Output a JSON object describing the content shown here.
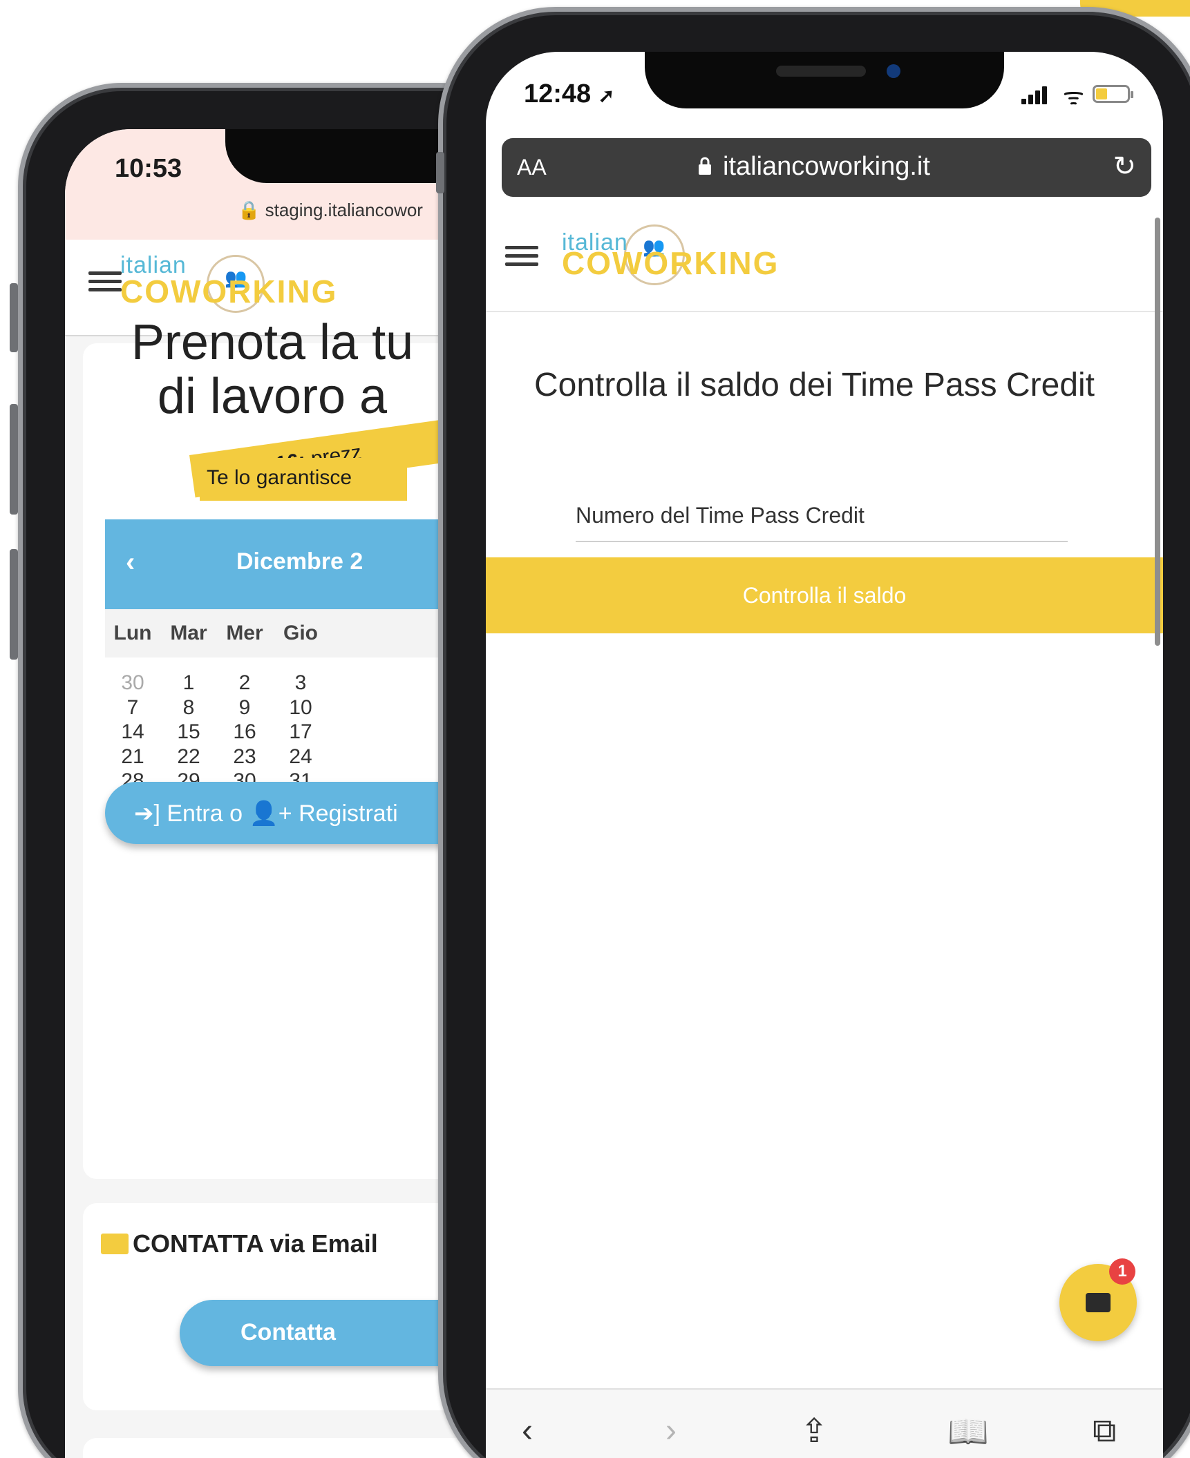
{
  "back_phone": {
    "status_time": "10:53",
    "url": "staging.italiancowor",
    "logo": {
      "top": "italian",
      "bottom": "COWORKING",
      "figures": "👥"
    },
    "hero_title_line1": "Prenota la tu",
    "hero_title_line2": "di lavoro a",
    "price_tag": {
      "strong": "a soli € 16",
      "sep": ": ",
      "link": "prezz"
    },
    "guarantee_tag": "Te lo garantisce",
    "calendar": {
      "prev_label": "‹",
      "month_label": "Dicembre 2",
      "weekdays": [
        "Lun",
        "Mar",
        "Mer",
        "Gio"
      ],
      "weeks": [
        [
          "30",
          "1",
          "2",
          "3"
        ],
        [
          "7",
          "8",
          "9",
          "10"
        ],
        [
          "14",
          "15",
          "16",
          "17"
        ],
        [
          "21",
          "22",
          "23",
          "24"
        ],
        [
          "28",
          "29",
          "30",
          "31"
        ]
      ]
    },
    "login_button": "➔] Entra o 👤+ Registrati",
    "contact_heading": "CONTATTA via Email",
    "contact_button": "Contatta"
  },
  "front_phone": {
    "status_time": "12:48",
    "location_arrow": "➚",
    "wifi_glyph": "ᯤ",
    "url_bar": {
      "text_size": "AA",
      "domain": "italiancoworking.it",
      "reload": "↻"
    },
    "logo": {
      "top": "italian",
      "bottom": "COWORKING",
      "figures": "👥"
    },
    "page_title": "Controlla il saldo dei Time Pass Credit",
    "input_placeholder": "Numero del Time Pass Credit",
    "submit_label": "Controlla il saldo",
    "chat_badge": "1",
    "toolbar": {
      "back": "‹",
      "forward": "›",
      "share": "⇪",
      "bookmarks": "📖",
      "tabs": "⧉"
    }
  },
  "colors": {
    "accent_yellow": "#f3cc3f",
    "accent_blue": "#63b6e0",
    "badge_red": "#e84242"
  }
}
